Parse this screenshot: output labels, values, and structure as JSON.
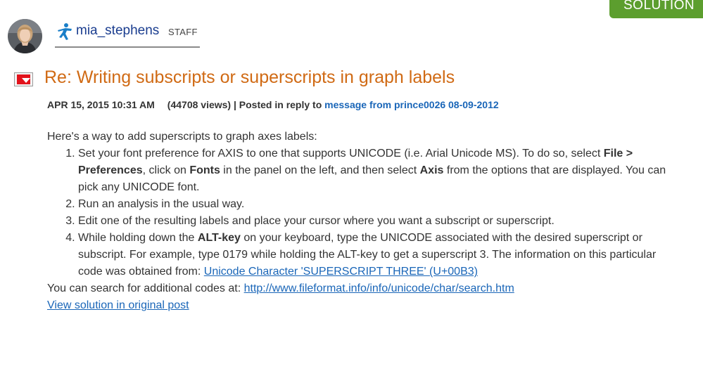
{
  "solution_badge": "SOLUTION",
  "author": {
    "username": "mia_stephens",
    "role": "STAFF"
  },
  "post": {
    "title": "Re: Writing subscripts or superscripts in graph labels",
    "date": "APR 15, 2015 10:31 AM",
    "views": "(44708 views)",
    "separator": "|",
    "reply_prefix": "Posted in reply to",
    "reply_link": "message from prince0026 08-09-2012",
    "intro": "Here's a way to add superscripts to graph axes labels:",
    "steps": {
      "s1": {
        "a": "Set your font preference for AXIS to one that supports UNICODE (i.e. Arial Unicode MS). To do so, select ",
        "b": "File > Preferences",
        "c": ", click on ",
        "d": "Fonts",
        "e": " in the panel on the left, and then select ",
        "f": "Axis",
        "g": " from the options that are displayed.  You can pick any UNICODE font."
      },
      "s2": "Run an analysis in the usual way.",
      "s3": "Edit one of the resulting labels and place your cursor where you want a subscript or superscript.",
      "s4": {
        "a": "While holding down the ",
        "b": "ALT-key",
        "c": " on your keyboard, type the UNICODE associated with the desired superscript or subscript. For example, type 0179 while holding the ALT-key to get a superscript 3. The information on this particular code was obtained from:  ",
        "link": "Unicode Character 'SUPERSCRIPT THREE' (U+00B3)"
      }
    },
    "search_prefix": "You can search for additional codes at: ",
    "search_link": "http://www.fileformat.info/info/unicode/char/search.htm",
    "view_solution": "View solution in original post"
  },
  "colors": {
    "title": "#d06a14",
    "link": "#1a66b8",
    "username": "#1a3d8f",
    "solution_badge": "#5c9e2e",
    "menu_toggle": "#e2121b"
  },
  "icons": {
    "rank": "runner-icon",
    "menu": "caret-down-icon",
    "avatar": "user-avatar"
  }
}
